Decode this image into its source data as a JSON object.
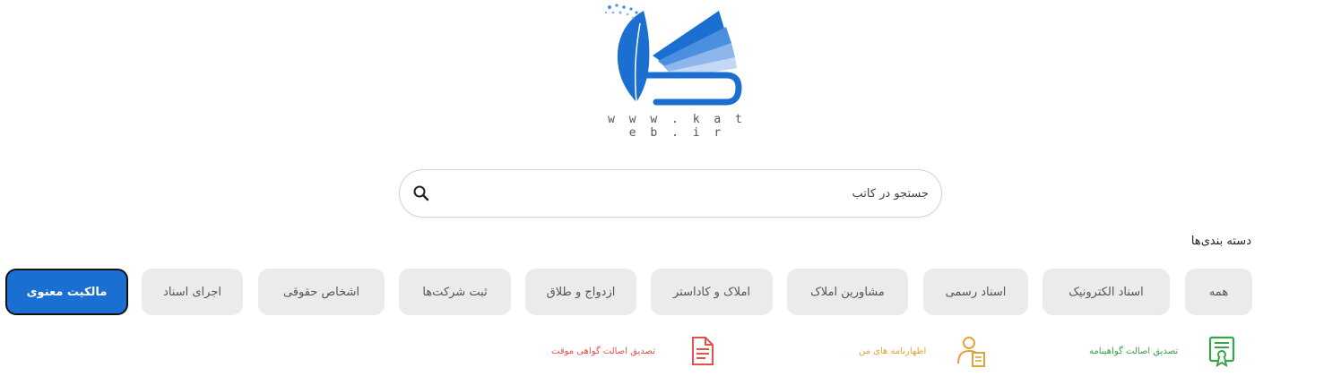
{
  "logo": {
    "url_text": "w w w . k a t e b . i r"
  },
  "search": {
    "placeholder": "جستجو در کاتب"
  },
  "categories": {
    "heading": "دسته بندی‌ها",
    "items": [
      {
        "label": "همه"
      },
      {
        "label": "اسناد الکترونیک"
      },
      {
        "label": "اسناد رسمی"
      },
      {
        "label": "مشاورین املاک"
      },
      {
        "label": "املاک و کاداستر"
      },
      {
        "label": "ازدواج و طلاق"
      },
      {
        "label": "ثبت شرکت‌ها"
      },
      {
        "label": "اشخاص حقوقی"
      },
      {
        "label": "اجرای اسناد"
      },
      {
        "label": "مالکیت معنوی",
        "active": true
      }
    ]
  },
  "services": [
    {
      "label": "تصدیق اصالت گواهینامه",
      "color": "#3aa34a",
      "icon": "certificate-icon"
    },
    {
      "label": "اظهارنامه های من",
      "color": "#e0a33a",
      "icon": "user-document-icon"
    },
    {
      "label": "تصدیق اصالت گواهی موقت",
      "color": "#e0524e",
      "icon": "document-icon"
    }
  ],
  "colors": {
    "accent": "#1a6fd1",
    "chip_bg": "#ebebeb"
  }
}
